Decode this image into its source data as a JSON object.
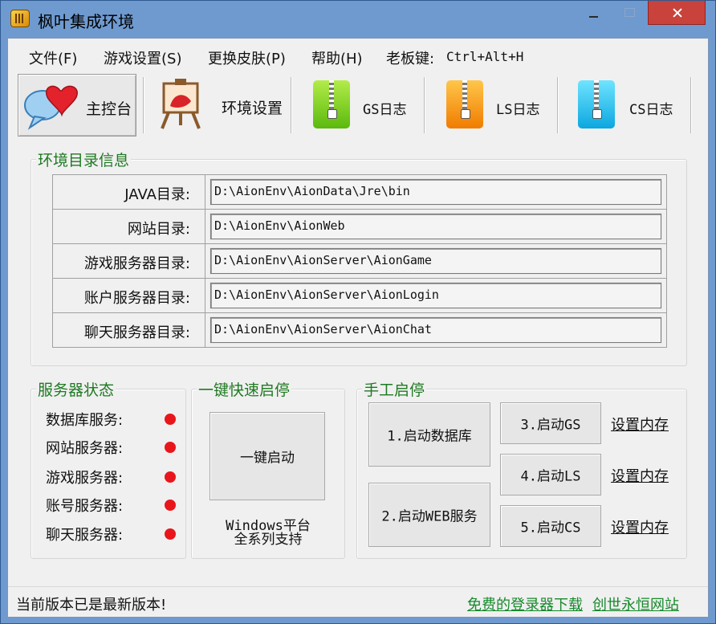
{
  "window": {
    "title": "枫叶集成环境"
  },
  "menu": [
    {
      "label": "文件(F)"
    },
    {
      "label": "游戏设置(S)"
    },
    {
      "label": "更换皮肤(P)"
    },
    {
      "label": "帮助(H)"
    },
    {
      "label": "老板键:"
    },
    {
      "label": "Ctrl+Alt+H"
    }
  ],
  "toolbar": [
    {
      "label": "主控台",
      "icon": "chat-bubbles-icon",
      "active": true
    },
    {
      "label": "环境设置",
      "icon": "easel-icon",
      "active": false
    },
    {
      "label": "GS日志",
      "icon": "zip-green-icon",
      "active": false
    },
    {
      "label": "LS日志",
      "icon": "zip-orange-icon",
      "active": false
    },
    {
      "label": "CS日志",
      "icon": "zip-cyan-icon",
      "active": false
    }
  ],
  "env": {
    "title": "环境目录信息",
    "rows": [
      {
        "label": "JAVA目录:",
        "value": "D:\\AionEnv\\AionData\\Jre\\bin"
      },
      {
        "label": "网站目录:",
        "value": "D:\\AionEnv\\AionWeb"
      },
      {
        "label": "游戏服务器目录:",
        "value": "D:\\AionEnv\\AionServer\\AionGame"
      },
      {
        "label": "账户服务器目录:",
        "value": "D:\\AionEnv\\AionServer\\AionLogin"
      },
      {
        "label": "聊天服务器目录:",
        "value": "D:\\AionEnv\\AionServer\\AionChat"
      }
    ]
  },
  "server_status": {
    "title": "服务器状态",
    "items": [
      {
        "label": "数据库服务:",
        "status_color": "#e8161b"
      },
      {
        "label": "网站服务器:",
        "status_color": "#e8161b"
      },
      {
        "label": "游戏服务器:",
        "status_color": "#e8161b"
      },
      {
        "label": "账号服务器:",
        "status_color": "#e8161b"
      },
      {
        "label": "聊天服务器:",
        "status_color": "#e8161b"
      }
    ]
  },
  "quick": {
    "title": "一键快速启停",
    "start_label": "一键启动",
    "support_line1": "Windows平台",
    "support_line2": "全系列支持"
  },
  "manual": {
    "title": "手工启停",
    "start_db": "1.启动数据库",
    "start_web": "2.启动WEB服务",
    "start_gs": "3.启动GS",
    "start_ls": "4.启动LS",
    "start_cs": "5.启动CS",
    "mem_label": "设置内存"
  },
  "footer": {
    "status": "当前版本已是最新版本!",
    "link_login": "免费的登录器下载",
    "link_site": "创世永恒网站"
  }
}
